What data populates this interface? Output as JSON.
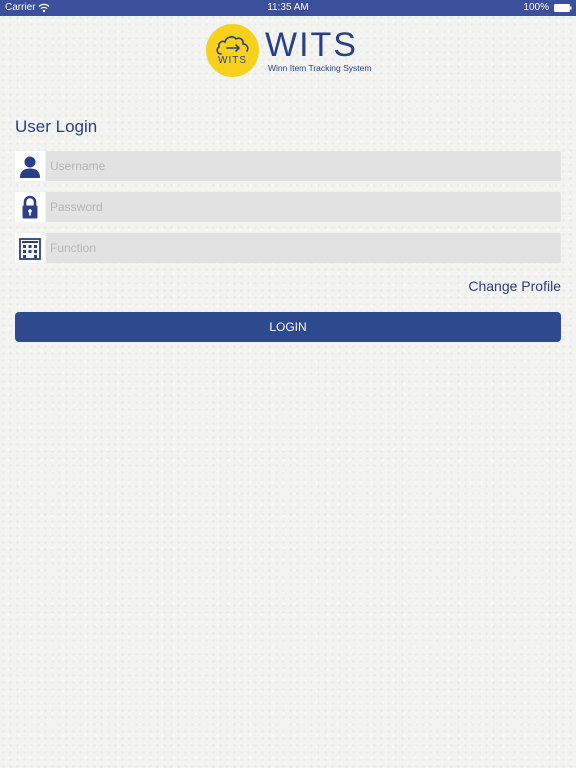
{
  "status_bar": {
    "carrier": "Carrier",
    "time": "11:35 AM",
    "battery": "100%",
    "wifi_icon": "wifi-icon",
    "battery_icon": "battery-icon"
  },
  "logo": {
    "badge_text": "WITS",
    "title": "WITS",
    "subtitle": "Winn Item Tracking System",
    "badge_color": "#f7d11e",
    "brand_color": "#2a3f86"
  },
  "login": {
    "title": "User Login",
    "fields": [
      {
        "icon": "user-icon",
        "placeholder": "Username",
        "value": ""
      },
      {
        "icon": "lock-icon",
        "placeholder": "Password",
        "value": ""
      },
      {
        "icon": "building-icon",
        "placeholder": "Function",
        "value": ""
      }
    ],
    "change_profile_label": "Change Profile",
    "login_label": "LOGIN",
    "button_color": "#2e4a8f"
  }
}
